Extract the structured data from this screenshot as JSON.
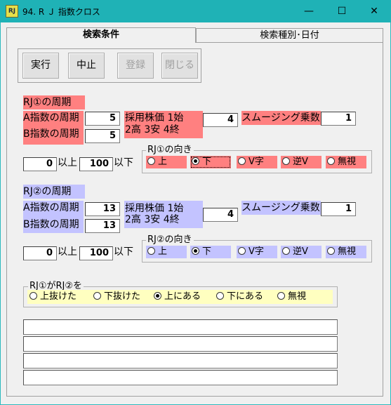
{
  "window": {
    "title": "94. R Ｊ 指数クロス",
    "icon": "app-icon",
    "min": "—",
    "max": "☐",
    "close": "✕"
  },
  "tabs": [
    {
      "label": "検索条件"
    },
    {
      "label": "検索種別･日付"
    }
  ],
  "toolbar": {
    "run": "実行",
    "stop": "中止",
    "register": "登録",
    "close": "閉じる"
  },
  "rj1": {
    "section_label": "RJ①の周期",
    "a_label": "A指数の周期",
    "a_value": "5",
    "b_label": "B指数の周期",
    "b_value": "5",
    "price_label_1": "採用株価 1始",
    "price_label_2": "2高  3安  4終",
    "price_value": "4",
    "smooth_label": "スムージング乗数",
    "smooth_value": "1",
    "min_value": "0",
    "min_suffix": "以上",
    "max_value": "100",
    "max_suffix": "以下",
    "direction_title": "RJ①の向き",
    "directions": [
      "上",
      "下",
      "V字",
      "逆V",
      "無視"
    ],
    "direction_selected": "下"
  },
  "rj2": {
    "section_label": "RJ②の周期",
    "a_label": "A指数の周期",
    "a_value": "13",
    "b_label": "B指数の周期",
    "b_value": "13",
    "price_label_1": "採用株価 1始",
    "price_label_2": "2高  3安  4終",
    "price_value": "4",
    "smooth_label": "スムージング乗数",
    "smooth_value": "1",
    "min_value": "0",
    "min_suffix": "以上",
    "max_value": "100",
    "max_suffix": "以下",
    "direction_title": "RJ②の向き",
    "directions": [
      "上",
      "下",
      "V字",
      "逆V",
      "無視"
    ],
    "direction_selected": "下"
  },
  "cross": {
    "title": "RJ①がRJ②を",
    "options": [
      "上抜けた",
      "下抜けた",
      "上にある",
      "下にある",
      "無視"
    ],
    "selected": "上にある"
  },
  "colors": {
    "titlebar": "#1fb2b6",
    "rj1": "#ff8080",
    "rj2": "#c3c3ff",
    "cross": "#ffffc0"
  }
}
